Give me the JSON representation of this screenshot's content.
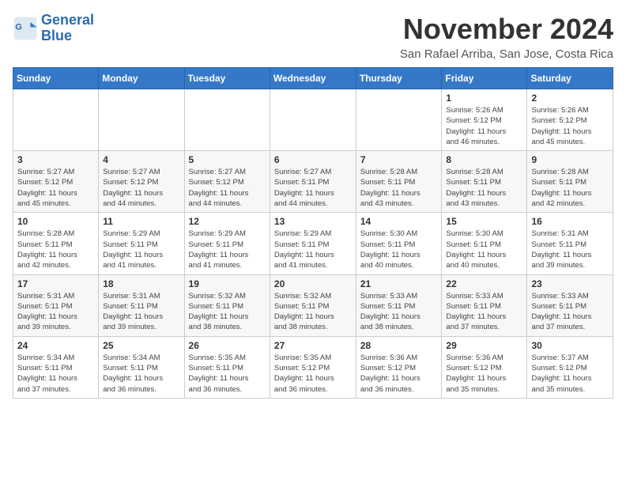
{
  "logo": {
    "name_line1": "General",
    "name_line2": "Blue"
  },
  "header": {
    "month_title": "November 2024",
    "subtitle": "San Rafael Arriba, San Jose, Costa Rica"
  },
  "weekdays": [
    "Sunday",
    "Monday",
    "Tuesday",
    "Wednesday",
    "Thursday",
    "Friday",
    "Saturday"
  ],
  "rows": [
    {
      "cells": [
        {
          "day": "",
          "info": ""
        },
        {
          "day": "",
          "info": ""
        },
        {
          "day": "",
          "info": ""
        },
        {
          "day": "",
          "info": ""
        },
        {
          "day": "",
          "info": ""
        },
        {
          "day": "1",
          "info": "Sunrise: 5:26 AM\nSunset: 5:12 PM\nDaylight: 11 hours\nand 46 minutes."
        },
        {
          "day": "2",
          "info": "Sunrise: 5:26 AM\nSunset: 5:12 PM\nDaylight: 11 hours\nand 45 minutes."
        }
      ]
    },
    {
      "cells": [
        {
          "day": "3",
          "info": "Sunrise: 5:27 AM\nSunset: 5:12 PM\nDaylight: 11 hours\nand 45 minutes."
        },
        {
          "day": "4",
          "info": "Sunrise: 5:27 AM\nSunset: 5:12 PM\nDaylight: 11 hours\nand 44 minutes."
        },
        {
          "day": "5",
          "info": "Sunrise: 5:27 AM\nSunset: 5:12 PM\nDaylight: 11 hours\nand 44 minutes."
        },
        {
          "day": "6",
          "info": "Sunrise: 5:27 AM\nSunset: 5:11 PM\nDaylight: 11 hours\nand 44 minutes."
        },
        {
          "day": "7",
          "info": "Sunrise: 5:28 AM\nSunset: 5:11 PM\nDaylight: 11 hours\nand 43 minutes."
        },
        {
          "day": "8",
          "info": "Sunrise: 5:28 AM\nSunset: 5:11 PM\nDaylight: 11 hours\nand 43 minutes."
        },
        {
          "day": "9",
          "info": "Sunrise: 5:28 AM\nSunset: 5:11 PM\nDaylight: 11 hours\nand 42 minutes."
        }
      ]
    },
    {
      "cells": [
        {
          "day": "10",
          "info": "Sunrise: 5:28 AM\nSunset: 5:11 PM\nDaylight: 11 hours\nand 42 minutes."
        },
        {
          "day": "11",
          "info": "Sunrise: 5:29 AM\nSunset: 5:11 PM\nDaylight: 11 hours\nand 41 minutes."
        },
        {
          "day": "12",
          "info": "Sunrise: 5:29 AM\nSunset: 5:11 PM\nDaylight: 11 hours\nand 41 minutes."
        },
        {
          "day": "13",
          "info": "Sunrise: 5:29 AM\nSunset: 5:11 PM\nDaylight: 11 hours\nand 41 minutes."
        },
        {
          "day": "14",
          "info": "Sunrise: 5:30 AM\nSunset: 5:11 PM\nDaylight: 11 hours\nand 40 minutes."
        },
        {
          "day": "15",
          "info": "Sunrise: 5:30 AM\nSunset: 5:11 PM\nDaylight: 11 hours\nand 40 minutes."
        },
        {
          "day": "16",
          "info": "Sunrise: 5:31 AM\nSunset: 5:11 PM\nDaylight: 11 hours\nand 39 minutes."
        }
      ]
    },
    {
      "cells": [
        {
          "day": "17",
          "info": "Sunrise: 5:31 AM\nSunset: 5:11 PM\nDaylight: 11 hours\nand 39 minutes."
        },
        {
          "day": "18",
          "info": "Sunrise: 5:31 AM\nSunset: 5:11 PM\nDaylight: 11 hours\nand 39 minutes."
        },
        {
          "day": "19",
          "info": "Sunrise: 5:32 AM\nSunset: 5:11 PM\nDaylight: 11 hours\nand 38 minutes."
        },
        {
          "day": "20",
          "info": "Sunrise: 5:32 AM\nSunset: 5:11 PM\nDaylight: 11 hours\nand 38 minutes."
        },
        {
          "day": "21",
          "info": "Sunrise: 5:33 AM\nSunset: 5:11 PM\nDaylight: 11 hours\nand 38 minutes."
        },
        {
          "day": "22",
          "info": "Sunrise: 5:33 AM\nSunset: 5:11 PM\nDaylight: 11 hours\nand 37 minutes."
        },
        {
          "day": "23",
          "info": "Sunrise: 5:33 AM\nSunset: 5:11 PM\nDaylight: 11 hours\nand 37 minutes."
        }
      ]
    },
    {
      "cells": [
        {
          "day": "24",
          "info": "Sunrise: 5:34 AM\nSunset: 5:11 PM\nDaylight: 11 hours\nand 37 minutes."
        },
        {
          "day": "25",
          "info": "Sunrise: 5:34 AM\nSunset: 5:11 PM\nDaylight: 11 hours\nand 36 minutes."
        },
        {
          "day": "26",
          "info": "Sunrise: 5:35 AM\nSunset: 5:11 PM\nDaylight: 11 hours\nand 36 minutes."
        },
        {
          "day": "27",
          "info": "Sunrise: 5:35 AM\nSunset: 5:12 PM\nDaylight: 11 hours\nand 36 minutes."
        },
        {
          "day": "28",
          "info": "Sunrise: 5:36 AM\nSunset: 5:12 PM\nDaylight: 11 hours\nand 36 minutes."
        },
        {
          "day": "29",
          "info": "Sunrise: 5:36 AM\nSunset: 5:12 PM\nDaylight: 11 hours\nand 35 minutes."
        },
        {
          "day": "30",
          "info": "Sunrise: 5:37 AM\nSunset: 5:12 PM\nDaylight: 11 hours\nand 35 minutes."
        }
      ]
    }
  ]
}
